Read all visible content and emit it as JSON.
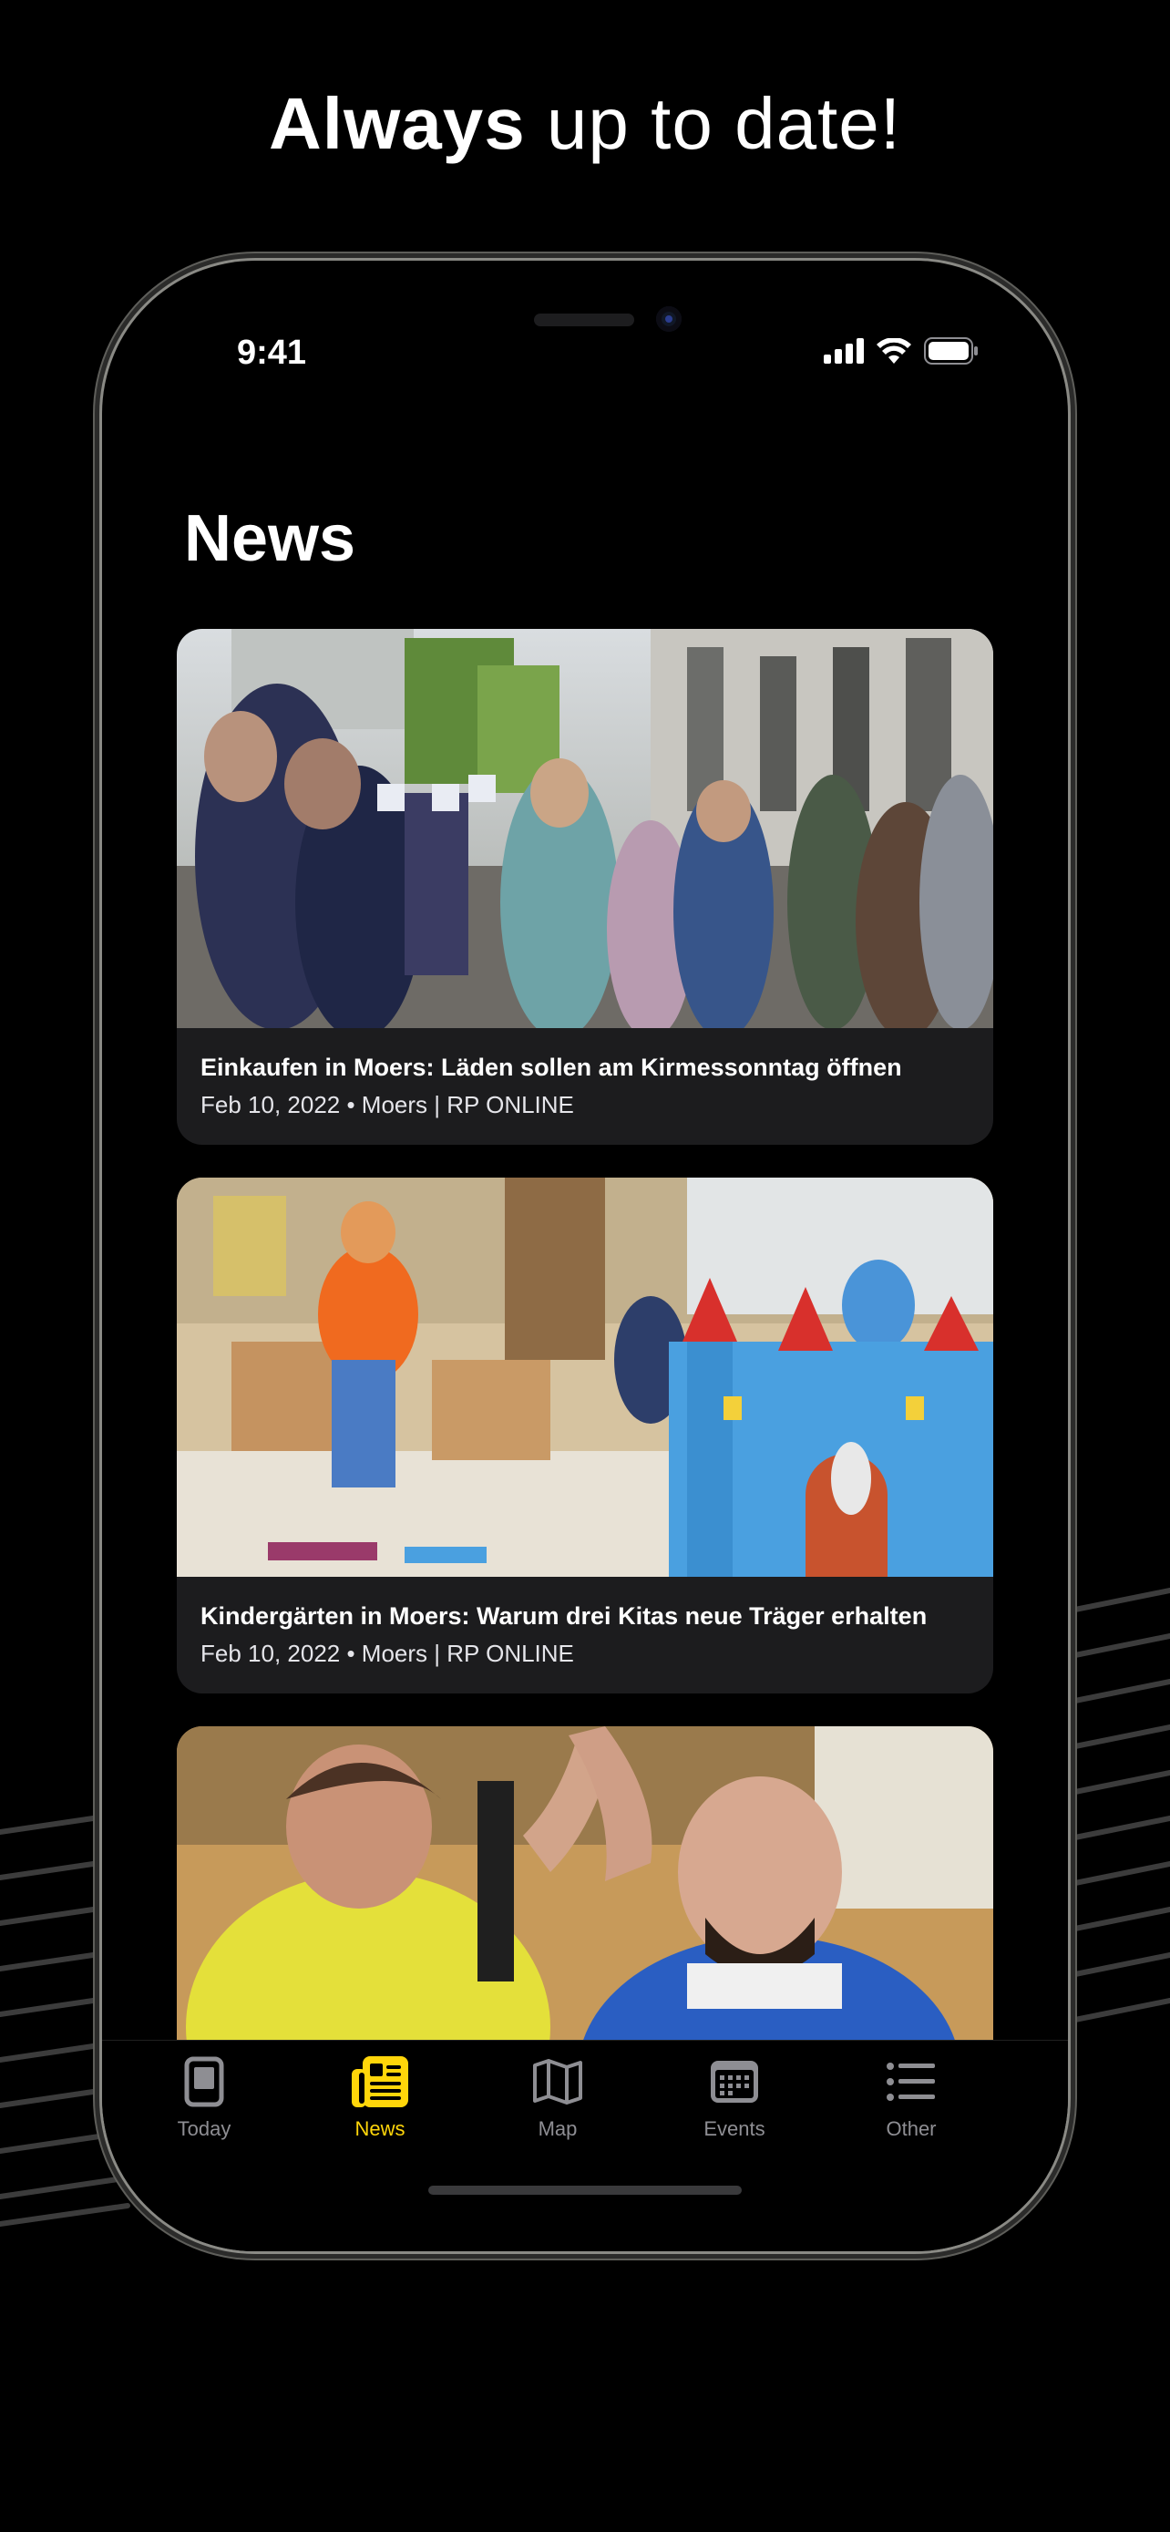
{
  "headline": {
    "bold": "Always",
    "rest": " up to date!"
  },
  "status": {
    "time": "9:41"
  },
  "page": {
    "title": "News"
  },
  "articles": [
    {
      "title": "Einkaufen in Moers: Läden sollen am Kirmessonntag öffnen",
      "meta": "Feb 10, 2022 • Moers | RP ONLINE",
      "image": "street-crowd-photo"
    },
    {
      "title": "Kindergärten in Moers: Warum drei Kitas neue Träger erhalten",
      "meta": "Feb 10, 2022 • Moers | RP ONLINE",
      "image": "kindergarten-photo"
    },
    {
      "title": "",
      "meta": "",
      "image": "handball-players-photo"
    }
  ],
  "tabs": [
    {
      "label": "Today",
      "icon": "tablet-icon",
      "active": false
    },
    {
      "label": "News",
      "icon": "newspaper-icon",
      "active": true
    },
    {
      "label": "Map",
      "icon": "map-icon",
      "active": false
    },
    {
      "label": "Events",
      "icon": "calendar-icon",
      "active": false
    },
    {
      "label": "Other",
      "icon": "list-icon",
      "active": false
    }
  ],
  "colors": {
    "accent": "#FFD60A",
    "card_bg": "#1C1C1E",
    "inactive": "#8E8E93"
  }
}
